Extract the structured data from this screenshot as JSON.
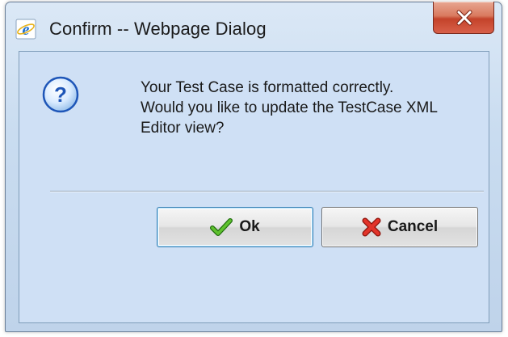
{
  "window": {
    "title": "Confirm -- Webpage Dialog",
    "title_icon": "ie-icon",
    "close_icon": "close-icon"
  },
  "dialog": {
    "icon": "question-icon",
    "message_lines": [
      "Your Test Case is formatted correctly.",
      "Would you like to update the TestCase XML",
      "Editor view?"
    ]
  },
  "buttons": {
    "ok": {
      "label": "Ok",
      "icon": "checkmark-icon",
      "icon_color": "#3a9a1c"
    },
    "cancel": {
      "label": "Cancel",
      "icon": "red-x-icon",
      "icon_color": "#d12a1e"
    }
  },
  "colors": {
    "content_background": "#cfe0f5",
    "close_button": "#c4432a"
  }
}
